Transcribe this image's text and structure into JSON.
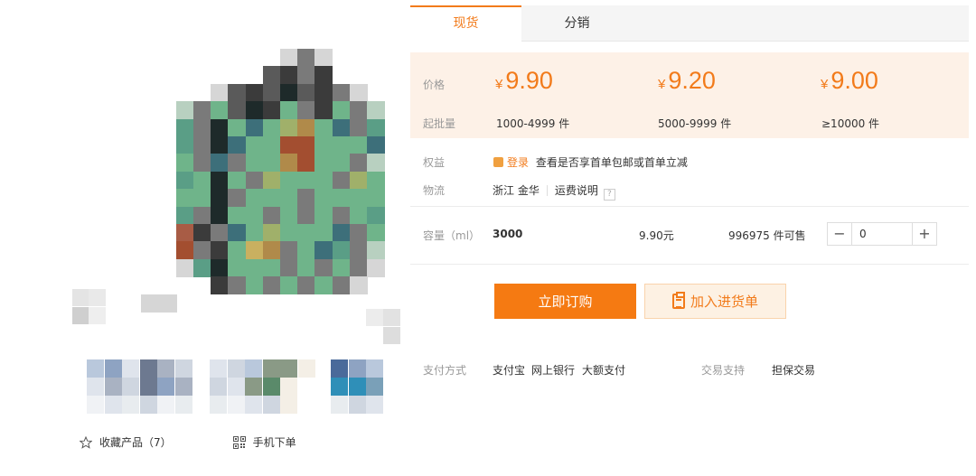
{
  "gallery": {
    "favorite_label": "收藏产品",
    "favorite_count": "（7）",
    "mobile_order_label": "手机下单"
  },
  "tabs": [
    {
      "label": "现货",
      "active": true
    },
    {
      "label": "分销",
      "active": false
    }
  ],
  "pricing": {
    "price_label": "价格",
    "moq_label": "起批量",
    "currency": "¥",
    "tiers": [
      {
        "price": "9.90",
        "range": "1000-4999 件"
      },
      {
        "price": "9.20",
        "range": "5000-9999 件"
      },
      {
        "price": "9.00",
        "range": "≥10000 件"
      }
    ]
  },
  "benefits": {
    "label": "权益",
    "login_link": "登录",
    "text": "查看是否享首单包邮或首单立减"
  },
  "logistics": {
    "label": "物流",
    "origin": "浙江 金华",
    "shipping_link": "运费说明",
    "help": "?"
  },
  "sku": {
    "label": "容量（ml）",
    "value": "3000",
    "price": "9.90元",
    "stock": "996975 件可售",
    "quantity": "0",
    "minus": "−",
    "plus": "+"
  },
  "buttons": {
    "buy_now": "立即订购",
    "add_to_cart": "加入进货单"
  },
  "payment": {
    "label": "支付方式",
    "methods": [
      "支付宝",
      "网上银行",
      "大额支付"
    ],
    "support_label": "交易支持",
    "support_value": "担保交易"
  },
  "colors": {
    "accent": "#f27b1b",
    "price_bg": "#fdf1e7"
  }
}
